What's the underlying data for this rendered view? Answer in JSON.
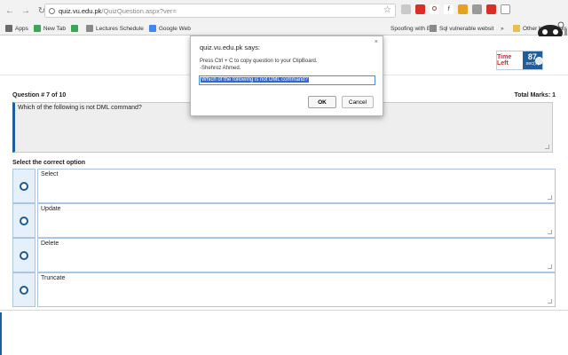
{
  "browser": {
    "url_host": "quiz.vu.edu.pk",
    "url_path": "/QuizQuestion.aspx?ver=",
    "bookmarks": [
      "Apps",
      "New Tab",
      "Lectures Schedule",
      "Google Web"
    ],
    "bookmarks_right": [
      "Spoofing with Et",
      "Sql vulnerable websit",
      "Other bookmarks"
    ]
  },
  "timer": {
    "label": "Time Left",
    "value": "87",
    "unit": "sec(s)"
  },
  "question": {
    "number_label": "Question # 7 of 10",
    "total_marks_label": "Total Marks: 1",
    "text": "Which of the following is not DML command?"
  },
  "answers": {
    "prompt": "Select the correct option",
    "options": [
      "Select",
      "Update",
      "Delete",
      "Truncate"
    ]
  },
  "dialog": {
    "title": "quiz.vu.edu.pk says:",
    "message_line1": "Press Ctrl + C to copy question to your ClipBoard.",
    "message_line2": "-Shehroz Ahmed.",
    "input_value": "Which of the following is not DML command?",
    "ok_label": "OK",
    "cancel_label": "Cancel",
    "close_glyph": "×"
  },
  "colors": {
    "accent": "#1f5e99",
    "timer_label": "#e02020",
    "selection": "#3367d6"
  }
}
